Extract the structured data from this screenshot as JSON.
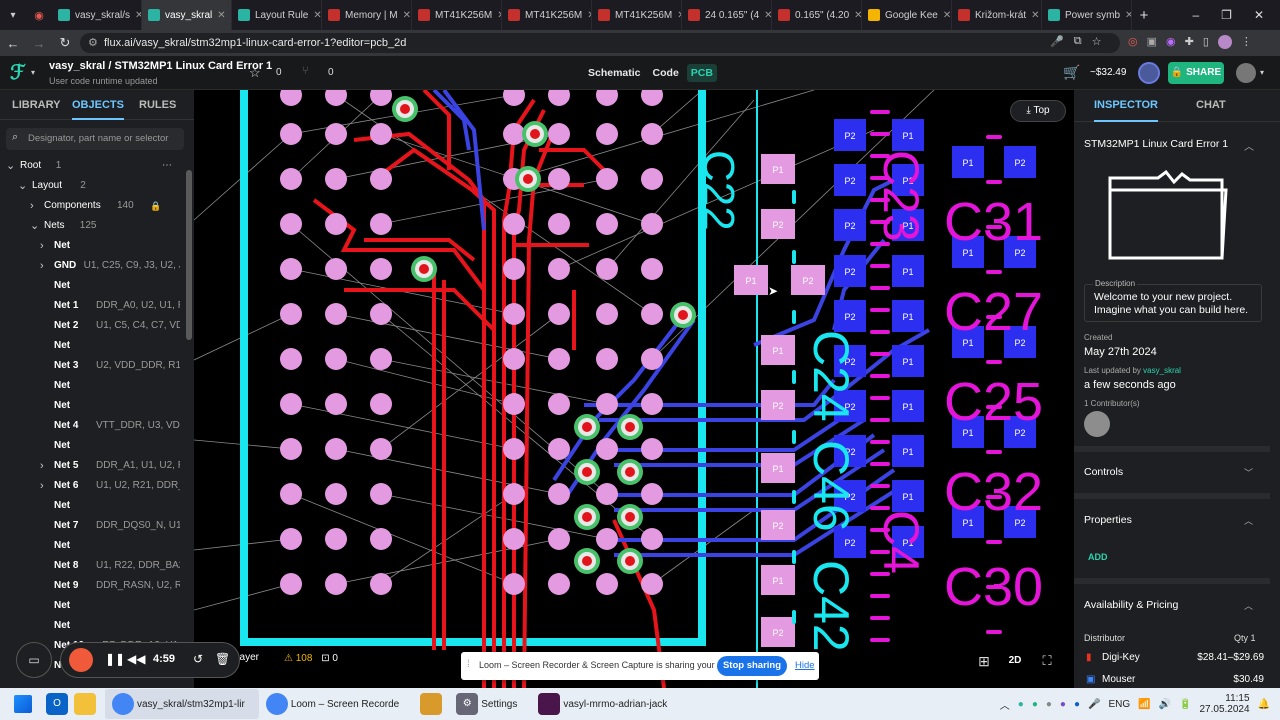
{
  "browser": {
    "tabs": [
      {
        "label": "vasy_skral/s",
        "icon": "flux-icon",
        "color": "#2bb3a3"
      },
      {
        "label": "vasy_skral",
        "icon": "flux-icon",
        "color": "#2bb3a3",
        "active": true
      },
      {
        "label": "Layout Rule",
        "icon": "flux-icon",
        "color": "#2bb3a3"
      },
      {
        "label": "Memory | M",
        "icon": "pdf-icon",
        "color": "#c4302b"
      },
      {
        "label": "MT41K256M",
        "icon": "pdf-icon",
        "color": "#c4302b"
      },
      {
        "label": "MT41K256M",
        "icon": "pdf-icon",
        "color": "#c4302b"
      },
      {
        "label": "MT41K256M",
        "icon": "pdf-icon",
        "color": "#c4302b"
      },
      {
        "label": "24 0.165\" (4",
        "icon": "pdf-icon",
        "color": "#c4302b"
      },
      {
        "label": "0.165\" (4.20",
        "icon": "pdf-icon",
        "color": "#c4302b"
      },
      {
        "label": "Google Kee",
        "icon": "keep-icon",
        "color": "#f4b400"
      },
      {
        "label": "Križom-krát",
        "icon": "uk-icon",
        "color": "#c4302b"
      },
      {
        "label": "Power symb",
        "icon": "flux-icon",
        "color": "#2bb3a3"
      }
    ],
    "url": "flux.ai/vasy_skral/stm32mp1-linux-card-error-1?editor=pcb_2d"
  },
  "header": {
    "user": "vasy_skral",
    "project": "STM32MP1 Linux Card Error 1",
    "subtitle": "User code runtime updated",
    "star_count": "0",
    "fork_count": "0",
    "modes": [
      "Schematic",
      "Code",
      "PCB"
    ],
    "active_mode": "PCB",
    "price": "~$32.49",
    "share": "SHARE"
  },
  "sidebar": {
    "tabs": [
      "LIBRARY",
      "OBJECTS",
      "RULES"
    ],
    "active_tab": "OBJECTS",
    "search_placeholder": "Designator, part name or selector",
    "tree": [
      {
        "name": "Root",
        "count": "1",
        "level": 0,
        "chev": "v"
      },
      {
        "name": "Layout",
        "count": "2",
        "level": 1,
        "chev": "v"
      },
      {
        "name": "Components",
        "count": "140",
        "level": 2,
        "chev": ">",
        "lock": true
      },
      {
        "name": "Nets",
        "count": "125",
        "level": 2,
        "chev": "v"
      },
      {
        "name": "Net",
        "detail": "",
        "level": 3,
        "chev": ">"
      },
      {
        "name": "GND",
        "detail": "U1, C25, C9, J3, U2, J...",
        "level": 3,
        "chev": ">"
      },
      {
        "name": "Net",
        "detail": "",
        "level": 3,
        "chev": ""
      },
      {
        "name": "Net 1",
        "detail": "DDR_A0, U2, U1, R5",
        "level": 3,
        "chev": ""
      },
      {
        "name": "Net 2",
        "detail": "U1, C5, C4, C7, VDD...",
        "level": 3,
        "chev": ""
      },
      {
        "name": "Net",
        "detail": "",
        "level": 3,
        "chev": ""
      },
      {
        "name": "Net 3",
        "detail": "U2, VDD_DDR, R12, ...",
        "level": 3,
        "chev": ""
      },
      {
        "name": "Net",
        "detail": "",
        "level": 3,
        "chev": ""
      },
      {
        "name": "Net",
        "detail": "",
        "level": 3,
        "chev": ""
      },
      {
        "name": "Net 4",
        "detail": "VTT_DDR, U3, VDD, ...",
        "level": 3,
        "chev": ""
      },
      {
        "name": "Net",
        "detail": "",
        "level": 3,
        "chev": ""
      },
      {
        "name": "Net 5",
        "detail": "DDR_A1, U1, U2, R6",
        "level": 3,
        "chev": ">"
      },
      {
        "name": "Net 6",
        "detail": "U1, U2, R21, DDR_BA1",
        "level": 3,
        "chev": ">"
      },
      {
        "name": "Net",
        "detail": "",
        "level": 3,
        "chev": ""
      },
      {
        "name": "Net 7",
        "detail": "DDR_DQS0_N, U1, U2",
        "level": 3,
        "chev": ""
      },
      {
        "name": "Net",
        "detail": "",
        "level": 3,
        "chev": ""
      },
      {
        "name": "Net 8",
        "detail": "U1, R22, DDR_BA2, U2",
        "level": 3,
        "chev": ""
      },
      {
        "name": "Net 9",
        "detail": "DDR_RASN, U2, R23,...",
        "level": 3,
        "chev": ""
      },
      {
        "name": "Net",
        "detail": "",
        "level": 3,
        "chev": ""
      },
      {
        "name": "Net",
        "detail": "",
        "level": 3,
        "chev": ""
      },
      {
        "name": "Net 10",
        "detail": "R7, DDR_A2, U1, U2",
        "level": 3,
        "chev": ""
      },
      {
        "name": "Net",
        "detail": "",
        "level": 3,
        "chev": ""
      }
    ]
  },
  "canvas": {
    "view_button": "Top",
    "layer_button": "Layer",
    "warnings": "108",
    "errors": "0",
    "mode_2d": "2D",
    "designators": [
      "C22",
      "C24",
      "C46",
      "C42",
      "C31",
      "C27",
      "C25",
      "C32",
      "C30",
      "C23",
      "C4"
    ]
  },
  "recorder": {
    "time": "4:59"
  },
  "loom_bar": {
    "message": "Loom – Screen Recorder & Screen Capture is sharing your screen.",
    "stop": "Stop sharing",
    "hide": "Hide"
  },
  "inspector": {
    "tabs": [
      "INSPECTOR",
      "CHAT"
    ],
    "active_tab": "INSPECTOR",
    "title": "STM32MP1 Linux Card Error 1",
    "description_label": "Description",
    "description": "Welcome to your new project. Imagine what you can build here.",
    "created_label": "Created",
    "created": "May 27th 2024",
    "updated_label": "Last updated by",
    "updated_by": "vasy_skral",
    "updated_ago": "a few seconds ago",
    "contributors": "1 Contributor(s)",
    "controls": "Controls",
    "properties": "Properties",
    "add": "ADD",
    "availability": "Availability & Pricing",
    "distributor_label": "Distributor",
    "qty_label": "Qty 1",
    "distributors": [
      {
        "name": "Digi-Key",
        "price": "$28.41–$29.69"
      },
      {
        "name": "Mouser",
        "price": "$30.49"
      }
    ]
  },
  "taskbar": {
    "items": [
      {
        "label": "vasy_skral/stm32mp1-lir",
        "icon": "chrome-icon"
      },
      {
        "label": "Loom – Screen Recorde",
        "icon": "chrome-icon"
      },
      {
        "label": "",
        "icon": "app-icon"
      },
      {
        "label": "Settings",
        "icon": "gear-icon"
      },
      {
        "label": "vasyl-mrmo-adrian-jack",
        "icon": "slack-icon"
      }
    ],
    "lang": "ENG",
    "time": "11:15",
    "date": "27.05.2024"
  }
}
